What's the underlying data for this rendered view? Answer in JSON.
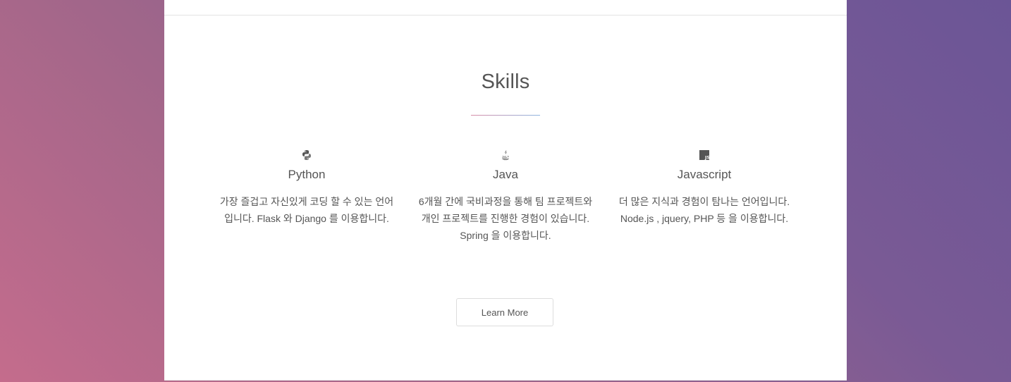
{
  "section": {
    "title": "Skills"
  },
  "skills": [
    {
      "icon": "python-icon",
      "name": "Python",
      "description": "가장 즐겁고 자신있게 코딩 할 수 있는 언어입니다. Flask 와 Django 를 이용합니다."
    },
    {
      "icon": "java-icon",
      "name": "Java",
      "description": "6개월 간에 국비과정을 통해 팀 프로젝트와 개인 프로젝트를 진행한 경험이 있습니다. Spring 을 이용합니다."
    },
    {
      "icon": "javascript-icon",
      "name": "Javascript",
      "description": "더 많은 지식과 경험이 탐나는 언어입니다. Node.js , jquery, PHP 등 을 이용합니다."
    }
  ],
  "actions": {
    "learn_more_label": "Learn More"
  },
  "colors": {
    "background_gradient_start": "#c46c8c",
    "background_gradient_end": "#6b5596",
    "panel": "#ffffff",
    "text": "#555555",
    "underline_pink": "#d88ea8",
    "underline_blue": "#8fb6e0"
  }
}
